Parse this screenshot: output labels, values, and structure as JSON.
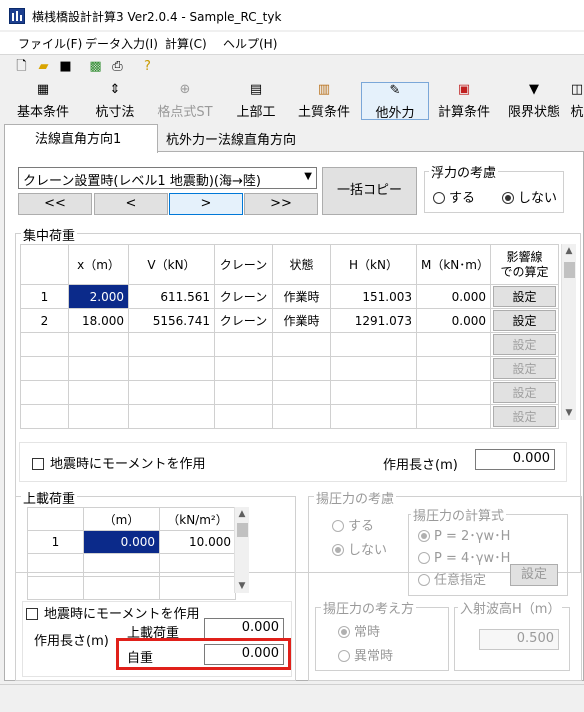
{
  "window": {
    "title": "横桟橋設計計算3 Ver2.0.4 - Sample_RC_tyk"
  },
  "menu": [
    {
      "label": "ファイル(F)"
    },
    {
      "label": "データ入力(I)"
    },
    {
      "label": "計算(C)"
    },
    {
      "label": "ヘルプ(H)"
    }
  ],
  "toolbar_icons": [
    "new-file-icon",
    "open-folder-icon",
    "save-icon",
    "calculator-icon",
    "print-icon",
    "help-icon"
  ],
  "main_toolbar": [
    {
      "label": "基本条件",
      "icon": "basic-conditions-icon",
      "glyph": "▦",
      "state": "normal"
    },
    {
      "label": "杭寸法",
      "icon": "pile-dimension-icon",
      "glyph": "⇕",
      "state": "normal"
    },
    {
      "label": "格点式ST",
      "icon": "node-st-icon",
      "glyph": "⊕",
      "state": "disabled"
    },
    {
      "label": "上部工",
      "icon": "superstructure-icon",
      "glyph": "▤",
      "state": "normal"
    },
    {
      "label": "土質条件",
      "icon": "soil-conditions-icon",
      "glyph": "▥",
      "state": "normal"
    },
    {
      "label": "他外力",
      "icon": "other-forces-icon",
      "glyph": "✎",
      "state": "active"
    },
    {
      "label": "計算条件",
      "icon": "calc-conditions-icon",
      "glyph": "▣",
      "state": "normal"
    },
    {
      "label": "限界状態",
      "icon": "limit-state-icon",
      "glyph": "▼",
      "state": "normal"
    },
    {
      "label": "杭",
      "icon": "pile-icon",
      "glyph": "◫",
      "state": "normal"
    }
  ],
  "tabs": [
    {
      "label": "法線直角方向1",
      "selected": true
    },
    {
      "label": "杭外力ー法線直角方向",
      "selected": false
    }
  ],
  "case_select": {
    "value": "クレーン設置時(レベル1 地震動)(海→陸)"
  },
  "nav_buttons": [
    "<<",
    "<",
    ">",
    ">>"
  ],
  "copy_button": "一括コピー",
  "buoyancy": {
    "title": "浮力の考慮",
    "options": [
      {
        "label": "する",
        "checked": false
      },
      {
        "label": "しない",
        "checked": true
      }
    ]
  },
  "concentrated_load": {
    "title": "集中荷重",
    "headers": [
      "",
      "x（m）",
      "V（kN）",
      "クレーン",
      "状態",
      "H（kN）",
      "M（kN･m）",
      "影響線\nでの算定"
    ],
    "rows": [
      {
        "no": "1",
        "x": "2.000",
        "v": "611.561",
        "crane": "クレーン",
        "state": "作業時",
        "h": "151.003",
        "m": "0.000",
        "btn": "設定"
      },
      {
        "no": "2",
        "x": "18.000",
        "v": "5156.741",
        "crane": "クレーン",
        "state": "作業時",
        "h": "1291.073",
        "m": "0.000",
        "btn": "設定"
      },
      {
        "no": "",
        "x": "",
        "v": "",
        "crane": "",
        "state": "",
        "h": "",
        "m": "",
        "btn": "設定"
      },
      {
        "no": "",
        "x": "",
        "v": "",
        "crane": "",
        "state": "",
        "h": "",
        "m": "",
        "btn": "設定"
      },
      {
        "no": "",
        "x": "",
        "v": "",
        "crane": "",
        "state": "",
        "h": "",
        "m": "",
        "btn": "設定"
      },
      {
        "no": "",
        "x": "",
        "v": "",
        "crane": "",
        "state": "",
        "h": "",
        "m": "",
        "btn": "設定"
      }
    ]
  },
  "seismic_moment_top": {
    "label": "地震時にモーメントを作用",
    "checked": false
  },
  "action_length_top": {
    "label": "作用長さ(m)",
    "value": "0.000"
  },
  "surcharge": {
    "title": "上載荷重",
    "headers": [
      "",
      "（m）",
      "（kN/m²）"
    ],
    "rows": [
      {
        "no": "1",
        "m": "0.000",
        "kn": "10.000"
      },
      {
        "no": "",
        "m": "",
        "kn": ""
      },
      {
        "no": "",
        "m": "",
        "kn": ""
      }
    ],
    "seismic_label": "地震時にモーメントを作用",
    "action_length_label": "作用長さ(m)",
    "surcharge_label": "上載荷重",
    "surcharge_value": "0.000",
    "selfweight_label": "自重",
    "selfweight_value": "0.000"
  },
  "uplift": {
    "title": "揚圧力の考慮",
    "options": [
      {
        "label": "する",
        "checked": false
      },
      {
        "label": "しない",
        "checked": true
      }
    ],
    "formula_title": "揚圧力の計算式",
    "formulas": [
      {
        "label": "P = 2･γw･H",
        "checked": true
      },
      {
        "label": "P = 4･γw･H",
        "checked": false
      },
      {
        "label": "任意指定",
        "checked": false
      }
    ],
    "formula_button": "設定",
    "approach_title": "揚圧力の考え方",
    "approaches": [
      {
        "label": "常時",
        "checked": true
      },
      {
        "label": "異常時",
        "checked": false
      }
    ],
    "wave_title": "入射波高H（m）",
    "wave_value": "0.500"
  },
  "highlight_color": "#e0201a"
}
